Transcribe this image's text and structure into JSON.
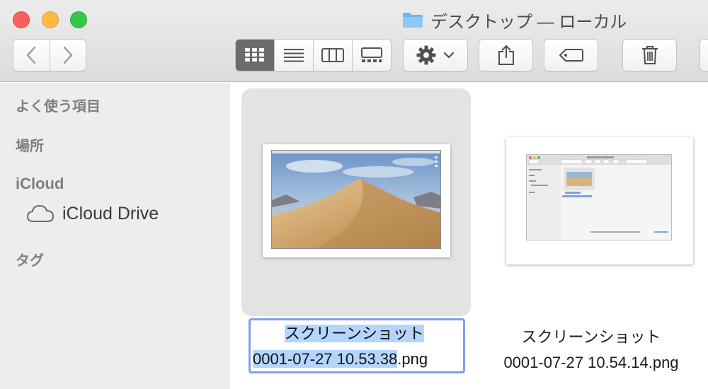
{
  "window": {
    "title": "デスクトップ — ローカル"
  },
  "toolbar": {
    "back_icon": "chevron-left-icon",
    "forward_icon": "chevron-right-icon",
    "views": [
      "icon-view",
      "list-view",
      "column-view",
      "gallery-view"
    ],
    "active_view": "icon-view",
    "action_icon": "gear-icon",
    "share_icon": "share-icon",
    "tag_icon": "tag-icon",
    "delete_icon": "trash-icon"
  },
  "sidebar": {
    "favorites": "よく使う項目",
    "locations": "場所",
    "icloud": "iCloud",
    "icloud_drive": "iCloud Drive",
    "tags": "タグ"
  },
  "files": [
    {
      "name_line1": "スクリーンショット",
      "name_line2_selected": "0001-07-27 10.53.38",
      "name_line2_ext": ".png",
      "selected": true,
      "editing": true
    },
    {
      "name_line1": "スクリーンショット",
      "name_line2": "0001-07-27 10.54.14.png",
      "selected": false
    }
  ],
  "colors": {
    "selection": "#b4d5fe",
    "focus_ring": "#7da1e8",
    "close": "#fc605c",
    "minimize": "#fdbc40",
    "maximize": "#34c84a"
  }
}
